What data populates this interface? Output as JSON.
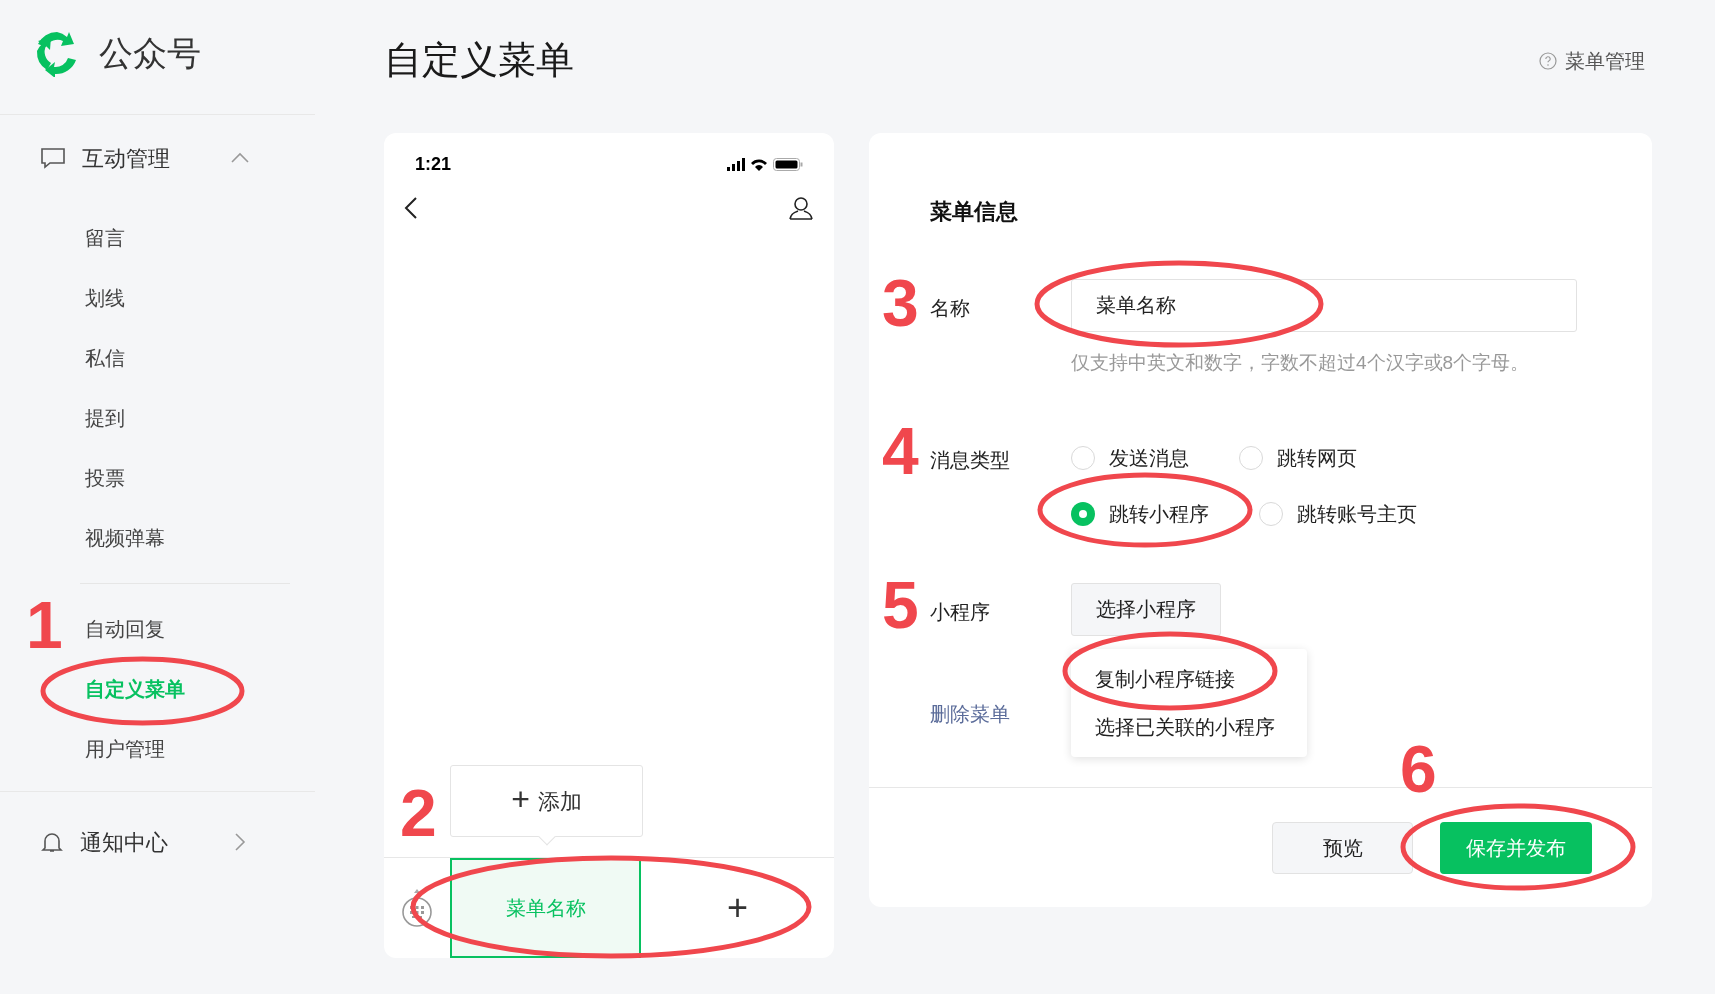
{
  "brand": {
    "name": "公众号"
  },
  "sidebar": {
    "groups": [
      {
        "label": "互动管理",
        "expanded": true,
        "items": [
          {
            "label": "留言",
            "selected": false
          },
          {
            "label": "划线",
            "selected": false
          },
          {
            "label": "私信",
            "selected": false
          },
          {
            "label": "提到",
            "selected": false
          },
          {
            "label": "投票",
            "selected": false
          },
          {
            "label": "视频弹幕",
            "selected": false
          },
          {
            "kind": "divider"
          },
          {
            "label": "自动回复",
            "selected": false
          },
          {
            "label": "自定义菜单",
            "selected": true
          },
          {
            "label": "用户管理",
            "selected": false
          }
        ]
      },
      {
        "label": "通知中心",
        "expanded": false
      }
    ]
  },
  "page": {
    "title": "自定义菜单",
    "help_link": "菜单管理"
  },
  "phone": {
    "time": "1:21",
    "add_popup": "添加",
    "add_icon": "+",
    "menu_tabs": [
      {
        "label": "菜单名称",
        "selected": true
      }
    ],
    "add_menu": "+"
  },
  "menu_info": {
    "title": "菜单信息",
    "name_label": "名称",
    "name_value": "菜单名称",
    "name_hint": "仅支持中英文和数字，字数不超过4个汉字或8个字母。",
    "type_label": "消息类型",
    "types": [
      {
        "label": "发送消息",
        "selected": false
      },
      {
        "label": "跳转网页",
        "selected": false
      },
      {
        "label": "跳转小程序",
        "selected": true
      },
      {
        "label": "跳转账号主页",
        "selected": false
      }
    ],
    "miniprogram_label": "小程序",
    "miniprogram_button": "选择小程序",
    "dropdown": [
      "复制小程序链接",
      "选择已关联的小程序"
    ],
    "delete_link": "删除菜单",
    "buttons": [
      {
        "label": "预览",
        "kind": "secondary"
      },
      {
        "label": "保存并发布",
        "kind": "primary"
      }
    ]
  },
  "annotations": [
    {
      "label": "1"
    },
    {
      "label": "2"
    },
    {
      "label": "3"
    },
    {
      "label": "4"
    },
    {
      "label": "5"
    },
    {
      "label": "6"
    }
  ]
}
